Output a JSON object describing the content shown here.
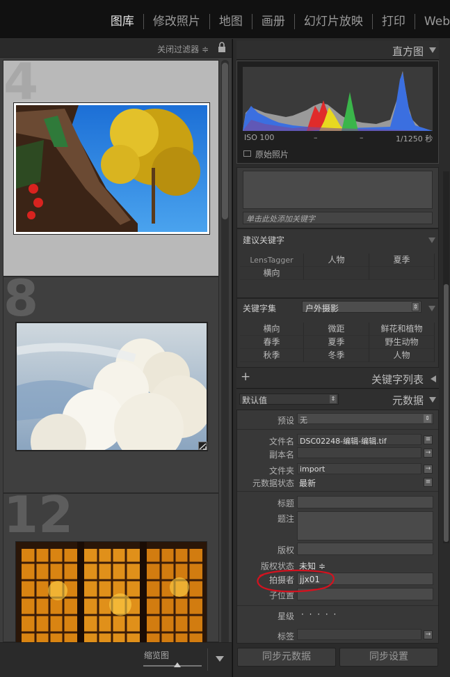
{
  "topbar": {
    "modules": [
      "图库",
      "修改照片",
      "地图",
      "画册",
      "幻灯片放映",
      "打印",
      "Web"
    ]
  },
  "filmstrip": {
    "filter_label": "关闭过滤器 ≑",
    "cells": [
      {
        "number": "4"
      },
      {
        "number": "8"
      },
      {
        "number": "12"
      }
    ],
    "footer_label": "缩览图"
  },
  "histogram": {
    "title": "直方图",
    "iso": "ISO 100",
    "dash1": "–",
    "dash2": "–",
    "shutter": "1/1250 秒",
    "original_photo": "原始照片"
  },
  "keywording": {
    "hint": "单击此处添加关键字",
    "suggested_title": "建议关键字",
    "suggested": [
      "LensTagger",
      "人物",
      "夏季",
      "横向",
      "",
      ""
    ],
    "set_label": "关键字集",
    "set_value": "户外摄影",
    "set_keywords": [
      "横向",
      "微距",
      "鲜花和植物",
      "春季",
      "夏季",
      "野生动物",
      "秋季",
      "冬季",
      "人物"
    ]
  },
  "keyword_list": {
    "title": "关键字列表",
    "add": "+"
  },
  "metadata": {
    "preset_select": "默认值",
    "title": "元数据",
    "preset_label": "预设",
    "preset_value": "无",
    "filename_label": "文件名",
    "filename_value": "DSC02248-编辑-编辑.tif",
    "copyname_label": "副本名",
    "folder_label": "文件夹",
    "folder_value": "import",
    "status_label": "元数据状态",
    "status_value": "最新",
    "title_label": "标题",
    "caption_label": "题注",
    "copyright_label": "版权",
    "copyright_status_label": "版权状态",
    "copyright_status_value": "未知 ≑",
    "creator_label": "拍摄者",
    "creator_value": "jjx01",
    "sublocation_label": "子位置",
    "rating_label": "星级",
    "rating_value": "· · · · ·",
    "label_label": "标签"
  },
  "bottom": {
    "sync_metadata": "同步元数据",
    "sync_settings": "同步设置"
  },
  "colors": {
    "annotation": "#d4121f",
    "histogram_blue": "#3b6fe0",
    "histogram_red": "#e02b2b",
    "histogram_yellow": "#e8d820",
    "histogram_green": "#3ab54a"
  }
}
